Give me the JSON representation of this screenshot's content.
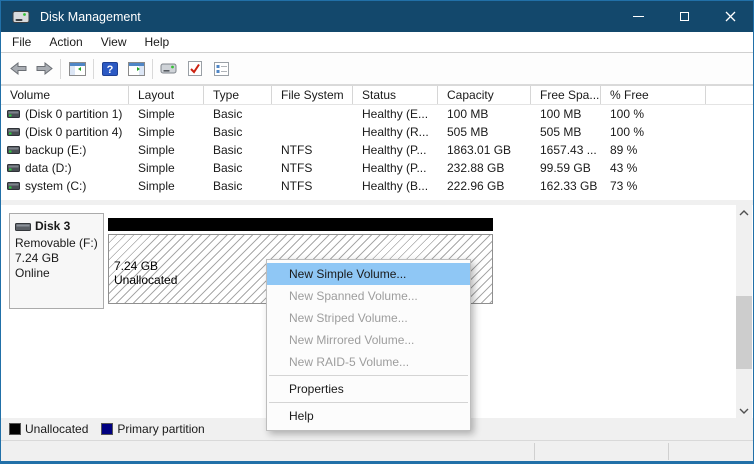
{
  "titlebar": {
    "title": "Disk Management",
    "icons": [
      "disk-drive-icon",
      "minimize-icon",
      "maximize-icon",
      "close-icon"
    ]
  },
  "menubar": {
    "items": [
      "File",
      "Action",
      "View",
      "Help"
    ]
  },
  "toolbar": {
    "icons": [
      "back-icon",
      "forward-icon",
      "console-tree-icon",
      "help-icon",
      "action-pane-icon",
      "device-icon",
      "check-document-icon",
      "checklist-icon"
    ]
  },
  "volume_table": {
    "columns": [
      "Volume",
      "Layout",
      "Type",
      "File System",
      "Status",
      "Capacity",
      "Free Spa...",
      "% Free"
    ],
    "rows": [
      {
        "volume": "(Disk 0 partition 1)",
        "layout": "Simple",
        "type": "Basic",
        "file_system": "",
        "status": "Healthy (E...",
        "capacity": "100 MB",
        "free_space": "100 MB",
        "percent_free": "100 %"
      },
      {
        "volume": "(Disk 0 partition 4)",
        "layout": "Simple",
        "type": "Basic",
        "file_system": "",
        "status": "Healthy (R...",
        "capacity": "505 MB",
        "free_space": "505 MB",
        "percent_free": "100 %"
      },
      {
        "volume": "backup (E:)",
        "layout": "Simple",
        "type": "Basic",
        "file_system": "NTFS",
        "status": "Healthy (P...",
        "capacity": "1863.01 GB",
        "free_space": "1657.43 ...",
        "percent_free": "89 %"
      },
      {
        "volume": "data (D:)",
        "layout": "Simple",
        "type": "Basic",
        "file_system": "NTFS",
        "status": "Healthy (P...",
        "capacity": "232.88 GB",
        "free_space": "99.59 GB",
        "percent_free": "43 %"
      },
      {
        "volume": "system (C:)",
        "layout": "Simple",
        "type": "Basic",
        "file_system": "NTFS",
        "status": "Healthy (B...",
        "capacity": "222.96 GB",
        "free_space": "162.33 GB",
        "percent_free": "73 %"
      }
    ]
  },
  "disk_panel": {
    "name": "Disk 3",
    "media": "Removable (F:)",
    "size": "7.24 GB",
    "status": "Online",
    "partition_size": "7.24 GB",
    "partition_label": "Unallocated"
  },
  "context_menu": {
    "items": [
      {
        "label": "New Simple Volume...",
        "state": "highlighted"
      },
      {
        "label": "New Spanned Volume...",
        "state": "disabled"
      },
      {
        "label": "New Striped Volume...",
        "state": "disabled"
      },
      {
        "label": "New Mirrored Volume...",
        "state": "disabled"
      },
      {
        "label": "New RAID-5 Volume...",
        "state": "disabled"
      },
      {
        "label": "Properties",
        "state": "enabled"
      },
      {
        "label": "Help",
        "state": "enabled"
      }
    ]
  },
  "legend": {
    "items": [
      {
        "label": "Unallocated",
        "color": "#000000"
      },
      {
        "label": "Primary partition",
        "color": "#000080"
      }
    ]
  },
  "colors": {
    "titlebar": "#13486c",
    "menu_highlight": "#8fc7f5",
    "window_border": "#2170a8",
    "unallocated": "#000000",
    "primary_partition": "#000080"
  }
}
